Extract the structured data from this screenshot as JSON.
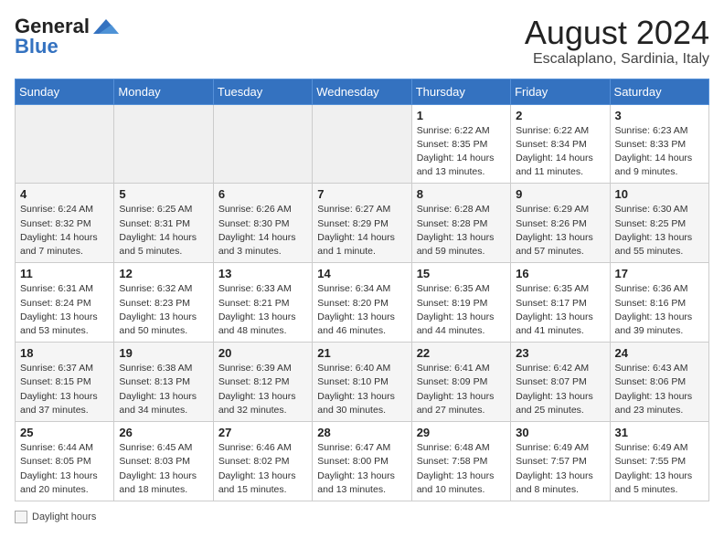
{
  "header": {
    "logo_general": "General",
    "logo_blue": "Blue",
    "month_year": "August 2024",
    "location": "Escalaplano, Sardinia, Italy"
  },
  "calendar": {
    "days_of_week": [
      "Sunday",
      "Monday",
      "Tuesday",
      "Wednesday",
      "Thursday",
      "Friday",
      "Saturday"
    ],
    "weeks": [
      [
        {
          "day": "",
          "info": ""
        },
        {
          "day": "",
          "info": ""
        },
        {
          "day": "",
          "info": ""
        },
        {
          "day": "",
          "info": ""
        },
        {
          "day": "1",
          "info": "Sunrise: 6:22 AM\nSunset: 8:35 PM\nDaylight: 14 hours\nand 13 minutes."
        },
        {
          "day": "2",
          "info": "Sunrise: 6:22 AM\nSunset: 8:34 PM\nDaylight: 14 hours\nand 11 minutes."
        },
        {
          "day": "3",
          "info": "Sunrise: 6:23 AM\nSunset: 8:33 PM\nDaylight: 14 hours\nand 9 minutes."
        }
      ],
      [
        {
          "day": "4",
          "info": "Sunrise: 6:24 AM\nSunset: 8:32 PM\nDaylight: 14 hours\nand 7 minutes."
        },
        {
          "day": "5",
          "info": "Sunrise: 6:25 AM\nSunset: 8:31 PM\nDaylight: 14 hours\nand 5 minutes."
        },
        {
          "day": "6",
          "info": "Sunrise: 6:26 AM\nSunset: 8:30 PM\nDaylight: 14 hours\nand 3 minutes."
        },
        {
          "day": "7",
          "info": "Sunrise: 6:27 AM\nSunset: 8:29 PM\nDaylight: 14 hours\nand 1 minute."
        },
        {
          "day": "8",
          "info": "Sunrise: 6:28 AM\nSunset: 8:28 PM\nDaylight: 13 hours\nand 59 minutes."
        },
        {
          "day": "9",
          "info": "Sunrise: 6:29 AM\nSunset: 8:26 PM\nDaylight: 13 hours\nand 57 minutes."
        },
        {
          "day": "10",
          "info": "Sunrise: 6:30 AM\nSunset: 8:25 PM\nDaylight: 13 hours\nand 55 minutes."
        }
      ],
      [
        {
          "day": "11",
          "info": "Sunrise: 6:31 AM\nSunset: 8:24 PM\nDaylight: 13 hours\nand 53 minutes."
        },
        {
          "day": "12",
          "info": "Sunrise: 6:32 AM\nSunset: 8:23 PM\nDaylight: 13 hours\nand 50 minutes."
        },
        {
          "day": "13",
          "info": "Sunrise: 6:33 AM\nSunset: 8:21 PM\nDaylight: 13 hours\nand 48 minutes."
        },
        {
          "day": "14",
          "info": "Sunrise: 6:34 AM\nSunset: 8:20 PM\nDaylight: 13 hours\nand 46 minutes."
        },
        {
          "day": "15",
          "info": "Sunrise: 6:35 AM\nSunset: 8:19 PM\nDaylight: 13 hours\nand 44 minutes."
        },
        {
          "day": "16",
          "info": "Sunrise: 6:35 AM\nSunset: 8:17 PM\nDaylight: 13 hours\nand 41 minutes."
        },
        {
          "day": "17",
          "info": "Sunrise: 6:36 AM\nSunset: 8:16 PM\nDaylight: 13 hours\nand 39 minutes."
        }
      ],
      [
        {
          "day": "18",
          "info": "Sunrise: 6:37 AM\nSunset: 8:15 PM\nDaylight: 13 hours\nand 37 minutes."
        },
        {
          "day": "19",
          "info": "Sunrise: 6:38 AM\nSunset: 8:13 PM\nDaylight: 13 hours\nand 34 minutes."
        },
        {
          "day": "20",
          "info": "Sunrise: 6:39 AM\nSunset: 8:12 PM\nDaylight: 13 hours\nand 32 minutes."
        },
        {
          "day": "21",
          "info": "Sunrise: 6:40 AM\nSunset: 8:10 PM\nDaylight: 13 hours\nand 30 minutes."
        },
        {
          "day": "22",
          "info": "Sunrise: 6:41 AM\nSunset: 8:09 PM\nDaylight: 13 hours\nand 27 minutes."
        },
        {
          "day": "23",
          "info": "Sunrise: 6:42 AM\nSunset: 8:07 PM\nDaylight: 13 hours\nand 25 minutes."
        },
        {
          "day": "24",
          "info": "Sunrise: 6:43 AM\nSunset: 8:06 PM\nDaylight: 13 hours\nand 23 minutes."
        }
      ],
      [
        {
          "day": "25",
          "info": "Sunrise: 6:44 AM\nSunset: 8:05 PM\nDaylight: 13 hours\nand 20 minutes."
        },
        {
          "day": "26",
          "info": "Sunrise: 6:45 AM\nSunset: 8:03 PM\nDaylight: 13 hours\nand 18 minutes."
        },
        {
          "day": "27",
          "info": "Sunrise: 6:46 AM\nSunset: 8:02 PM\nDaylight: 13 hours\nand 15 minutes."
        },
        {
          "day": "28",
          "info": "Sunrise: 6:47 AM\nSunset: 8:00 PM\nDaylight: 13 hours\nand 13 minutes."
        },
        {
          "day": "29",
          "info": "Sunrise: 6:48 AM\nSunset: 7:58 PM\nDaylight: 13 hours\nand 10 minutes."
        },
        {
          "day": "30",
          "info": "Sunrise: 6:49 AM\nSunset: 7:57 PM\nDaylight: 13 hours\nand 8 minutes."
        },
        {
          "day": "31",
          "info": "Sunrise: 6:49 AM\nSunset: 7:55 PM\nDaylight: 13 hours\nand 5 minutes."
        }
      ]
    ]
  },
  "legend": {
    "daylight_label": "Daylight hours"
  }
}
